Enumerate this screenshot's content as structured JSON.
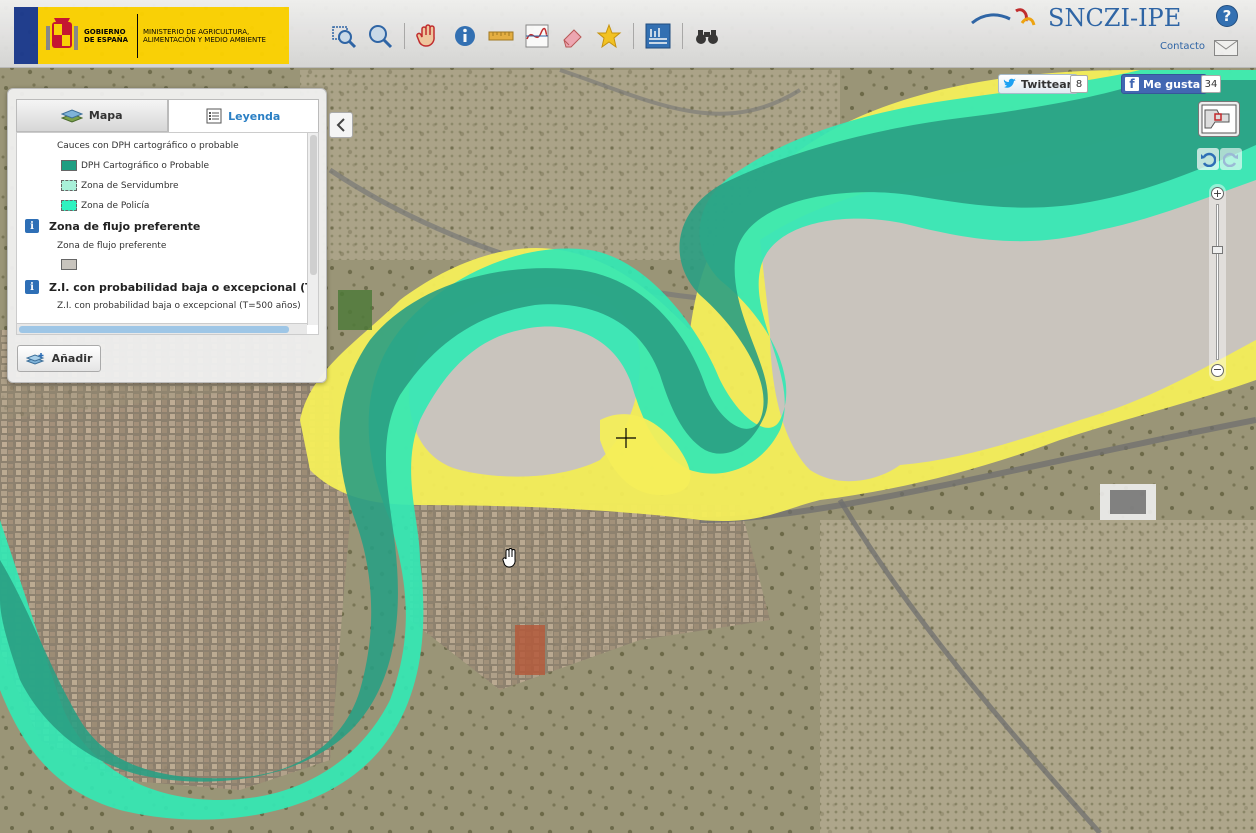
{
  "header": {
    "gov_line1": "GOBIERNO DE ESPAÑA",
    "ministry_line": "MINISTERIO DE AGRICULTURA, ALIMENTACIÓN Y MEDIO AMBIENTE",
    "brand": "SNCZI-IPE",
    "help": "?",
    "contact": "Contacto"
  },
  "toolbar": {
    "icons": [
      "zoom-box-icon",
      "zoom-out-icon",
      "pan-hand-icon",
      "info-icon",
      "measure-ruler-icon",
      "profile-icon",
      "eraser-icon",
      "favorite-star-icon",
      "flood-layer-icon",
      "search-binoculars-icon"
    ]
  },
  "social": {
    "tweet_label": "Twittear",
    "tweet_count": "8",
    "fb_label": "Me gusta",
    "fb_count": "34"
  },
  "panel": {
    "tabs": [
      {
        "label": "Mapa",
        "active": false
      },
      {
        "label": "Leyenda",
        "active": true
      }
    ],
    "legend": {
      "cauces_title": "Cauces con DPH cartográfico o probable",
      "items": [
        {
          "label": "DPH Cartográfico o Probable",
          "color": "#1f9e82"
        },
        {
          "label": "Zona de Servidumbre",
          "color": "#a9f0d9"
        },
        {
          "label": "Zona de Policía",
          "color": "#2ff2c0"
        }
      ],
      "flujo_heading": "Zona de flujo preferente",
      "flujo_item": "Zona de flujo preferente",
      "flujo_color": "#c8c4bd",
      "zi_heading": "Z.I. con probabilidad baja o excepcional (T=...",
      "zi_item": "Z.I. con probabilidad baja o excepcional (T=500 años)"
    },
    "add_label": "Añadir"
  },
  "map": {
    "colors": {
      "yellow": "#f4ee5a",
      "teal_light": "#33e8b4",
      "teal_dark": "#2a9f83",
      "grey": "#c9c4bd"
    }
  },
  "zoom": {
    "in": "+",
    "out": "−"
  }
}
